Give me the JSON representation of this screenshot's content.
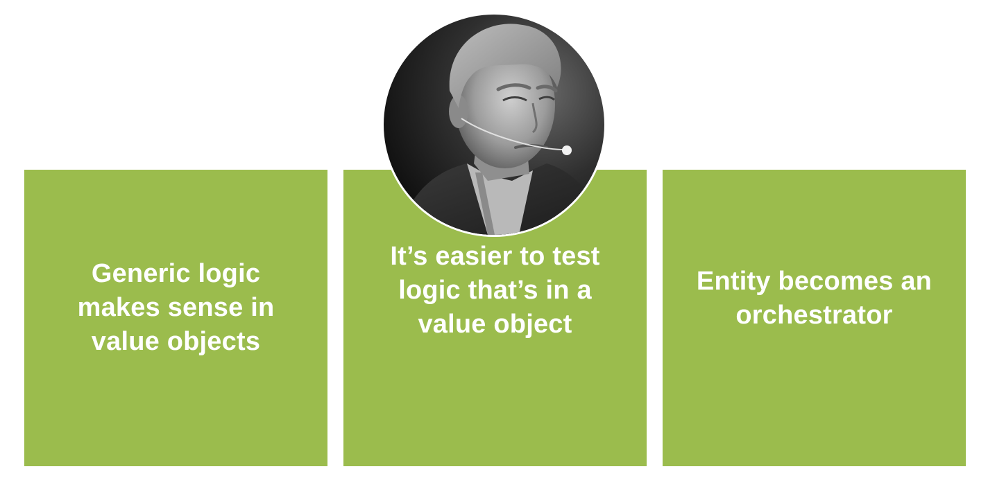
{
  "panels": [
    {
      "text": "Generic logic\nmakes sense in\nvalue objects"
    },
    {
      "text": "It’s easier to test\nlogic that’s in a\nvalue object"
    },
    {
      "text": "Entity becomes an\norchestrator"
    }
  ],
  "portrait": {
    "subject": "speaker-headshot",
    "style": "grayscale"
  },
  "colors": {
    "panel": "#9bbc4d",
    "panel_text": "#ffffff",
    "background": "#ffffff"
  }
}
